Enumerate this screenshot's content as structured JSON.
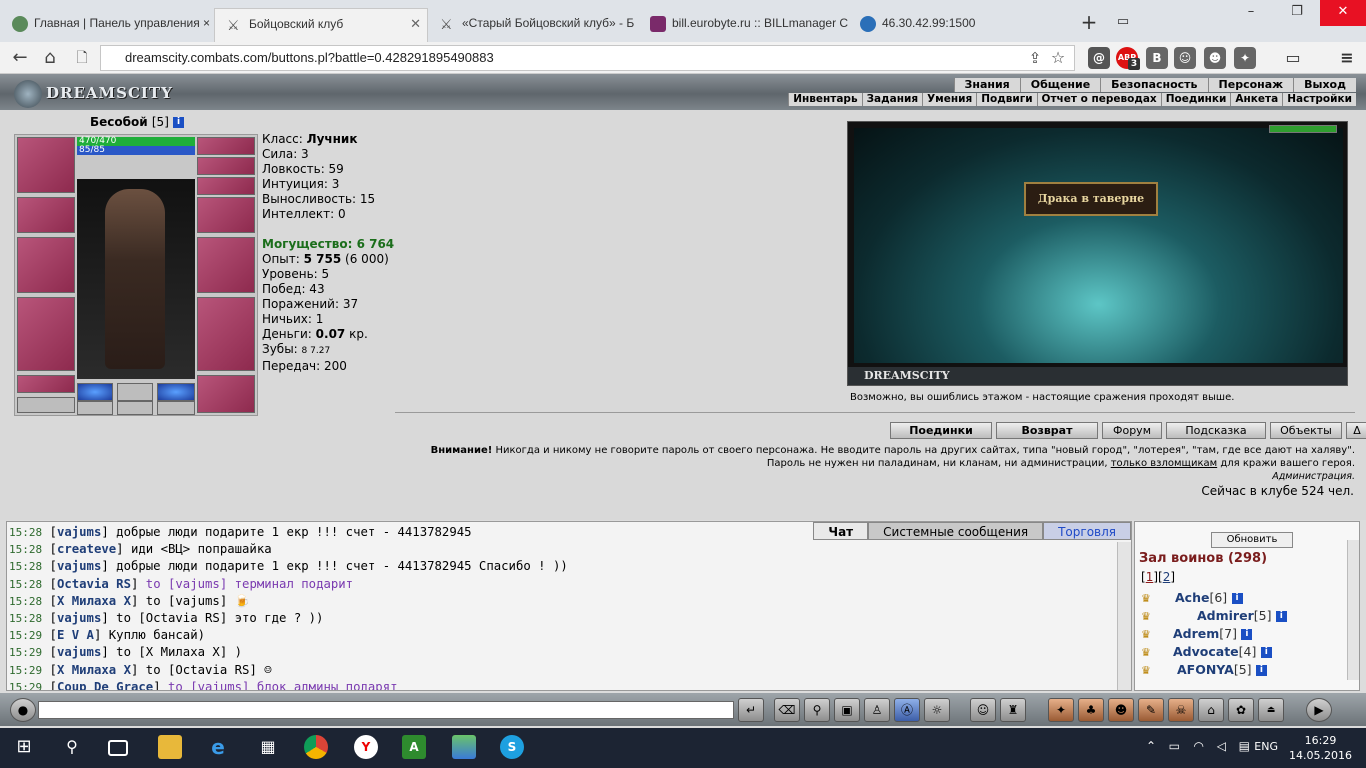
{
  "browser": {
    "tabs": [
      {
        "label": "Главная | Панель управления ×",
        "active": false
      },
      {
        "label": "Бойцовский клуб",
        "active": true
      },
      {
        "label": "«Старый Бойцовский клуб» - Б",
        "active": false
      },
      {
        "label": "bill.eurobyte.ru :: BILLmanager С",
        "active": false
      },
      {
        "label": "46.30.42.99:1500",
        "active": false
      }
    ],
    "url": "dreamscity.combats.com/buttons.pl?battle=0.428291895490883",
    "abp_badge": "3"
  },
  "game": {
    "logo": "DREAMSCITY",
    "main_menu": [
      "Знания",
      "Общение",
      "Безопасность",
      "Персонаж",
      "Выход"
    ],
    "sub_menu": [
      "Инвентарь",
      "Задания",
      "Умения",
      "Подвиги",
      "Отчет о переводах",
      "Поединки",
      "Анкета",
      "Настройки"
    ]
  },
  "character": {
    "name": "Бесобой",
    "level": "[5]",
    "hp": "470/470",
    "mp": "85/85",
    "class_label": "Класс:",
    "class_value": "Лучник",
    "attrs": [
      {
        "label": "Сила: 3"
      },
      {
        "label": "Ловкость: 59"
      },
      {
        "label": "Интуиция: 3"
      },
      {
        "label": "Выносливость: 15"
      },
      {
        "label": "Интеллект: 0"
      }
    ],
    "power_label": "Могущество: 6 764",
    "exp_label": "Опыт:",
    "exp_value": "5 755",
    "exp_next": "(6 000)",
    "level_line": "Уровень: 5",
    "wins": "Побед: 43",
    "losses": "Поражений: 37",
    "draws": "Ничьих: 1",
    "money_label": "Деньги:",
    "money_value": "0.07",
    "money_unit": "кр.",
    "teeth_label": "Зубы:",
    "teeth_value": "8 7.27",
    "transfers": "Передач: 200"
  },
  "scene": {
    "sign": "Драка в таверне",
    "footer": "DREAMSCITY",
    "floor_note": "Возможно, вы ошиблись этажом - настоящие сражения проходят выше."
  },
  "actions": [
    "Поединки",
    "Возврат",
    "Форум",
    "Подсказка",
    "Объекты",
    "Δ"
  ],
  "warning": {
    "bold": "Внимание!",
    "text": " Никогда и никому не говорите пароль от своего персонажа. Не вводите пароль на других сайтах, типа \"новый город\", \"лотерея\", \"там, где все дают на халяву\". Пароль не нужен ни паладинам, ни кланам, ни администрации, ",
    "link": "только взломщикам",
    "tail": " для кражи вашего героя.",
    "signature": "Администрация."
  },
  "online": "Сейчас в клубе 524 чел.",
  "chat": {
    "tabs": [
      "Чат",
      "Системные сообщения",
      "Торговля"
    ],
    "lines": [
      {
        "time": "15:28",
        "nick": "vajums",
        "text": " добрые люди подарите 1 екр !!! счет - 4413782945",
        "private": false
      },
      {
        "time": "15:28",
        "nick": "createve",
        "text": " иди <ВЦ> попрашайка",
        "private": false
      },
      {
        "time": "15:28",
        "nick": "vajums",
        "text": " добрые люди подарите 1 екр !!! счет - 4413782945 Спасибо ! ))",
        "private": false
      },
      {
        "time": "15:28",
        "nick": "Octavia RS",
        "text": " to [vajums] терминал подарит",
        "private": true
      },
      {
        "time": "15:28",
        "nick": "X Милаха X",
        "text": " to [vajums] 🍺",
        "private": false
      },
      {
        "time": "15:28",
        "nick": "vajums",
        "text": " to [Octavia RS] это где ? ))",
        "private": false
      },
      {
        "time": "15:29",
        "nick": "E V A",
        "text": " Куплю бансай)",
        "private": false
      },
      {
        "time": "15:29",
        "nick": "vajums",
        "text": " to [X Милаха X] )",
        "private": false
      },
      {
        "time": "15:29",
        "nick": "X Милаха X",
        "text": " to [Octavia RS] ☺",
        "private": false
      },
      {
        "time": "15:29",
        "nick": "Coup De Grace",
        "text": " to [vajums] блок админы подарят",
        "private": true
      }
    ]
  },
  "players": {
    "refresh": "Обновить",
    "hall": "Зал воинов (298)",
    "page1": "1",
    "page2": "2",
    "list": [
      {
        "name": "Ache",
        "level": "[6]"
      },
      {
        "name": "Admirer",
        "level": "[5]"
      },
      {
        "name": "Adrem",
        "level": "[7]"
      },
      {
        "name": "Advocate",
        "level": "[4]"
      },
      {
        "name": "AFONYA",
        "level": "[5]"
      }
    ]
  },
  "taskbar": {
    "lang": "ENG",
    "time": "16:29",
    "date": "14.05.2016"
  }
}
